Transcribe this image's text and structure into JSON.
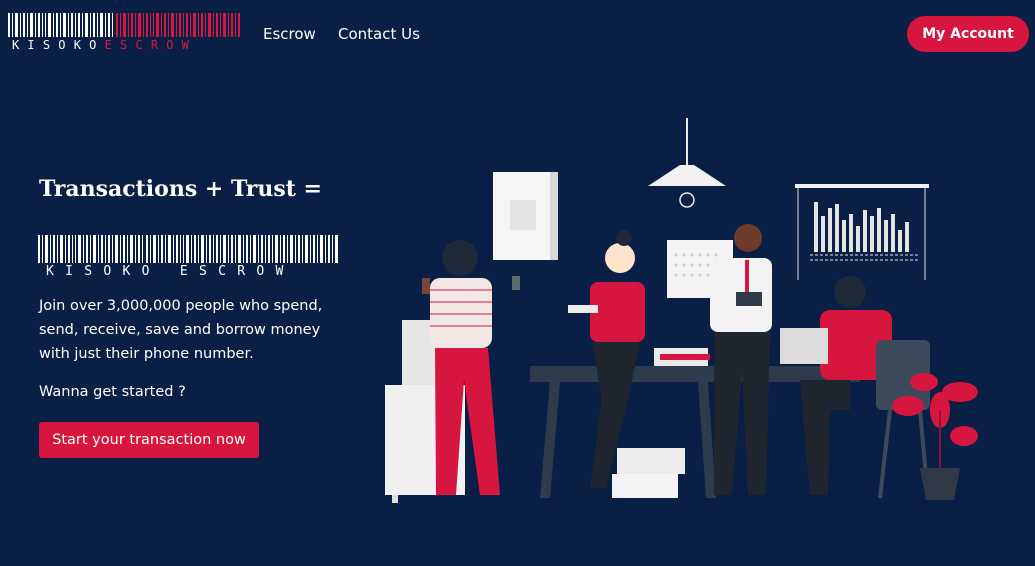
{
  "brand": {
    "part1": "KISOKO",
    "part2": "ESCROW"
  },
  "nav": {
    "links": [
      "Escrow",
      "Contact Us"
    ],
    "account_label": "My Account"
  },
  "hero": {
    "headline": "Transactions + Trust =",
    "logo_text": "KISOKO ESCROW",
    "description": "Join over 3,000,000 people who spend, send, receive, save and borrow money with just their phone number.",
    "prompt": "Wanna get started ?",
    "cta_label": "Start your transaction now"
  },
  "colors": {
    "background": "#0a1f45",
    "accent": "#d7163f",
    "text": "#ffffff"
  },
  "icons": {
    "hero_art": "office-team-illustration"
  }
}
